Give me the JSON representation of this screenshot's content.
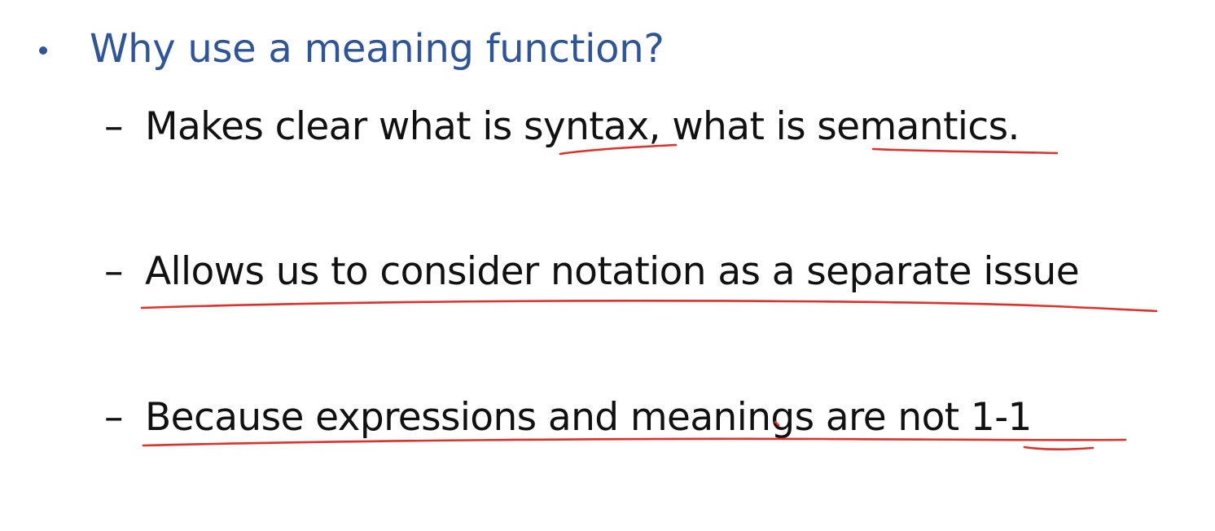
{
  "slide": {
    "heading": "Why use a meaning function?",
    "points": [
      {
        "dash": "–",
        "text": "Makes clear what is syntax, what is semantics."
      },
      {
        "dash": "–",
        "text": "Allows us to consider notation as a separate issue"
      },
      {
        "dash": "–",
        "text": "Because expressions and meanings are not 1-1"
      }
    ]
  },
  "colors": {
    "heading": "#2f5597",
    "body_text": "#111111",
    "annotation_ink": "#e0302a",
    "background": "#ffffff"
  },
  "icons": {
    "bullet": "bullet-dot-icon"
  }
}
